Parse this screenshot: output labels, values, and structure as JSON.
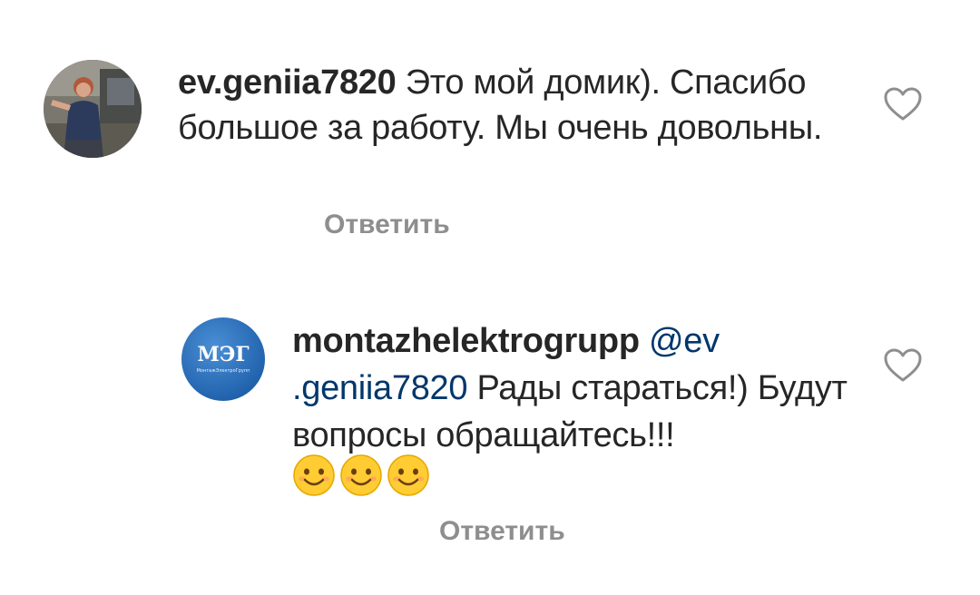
{
  "comments": [
    {
      "username": "ev.geniia7820",
      "text": "Это мой домик). Спасибо большое за работу. Мы очень довольны.",
      "reply_label": "Ответить",
      "avatar_icon": "user-photo-avatar",
      "like_icon": "heart-outline-icon"
    },
    {
      "username": "montazhelektrogrupp",
      "mention": "@ev .geniia7820",
      "text": "Рады стараться!) Будут вопросы обращайтесь!!!",
      "emojis": [
        "😊",
        "😊",
        "😊"
      ],
      "reply_label": "Ответить",
      "avatar_logo_text": "МЭГ",
      "avatar_logo_subtext": "МонтажЭлектроГрупп",
      "like_icon": "heart-outline-icon"
    }
  ],
  "colors": {
    "text": "#262626",
    "muted": "#8e8e8e",
    "mention": "#00376b",
    "logo_blue": "#2b6fb8"
  }
}
